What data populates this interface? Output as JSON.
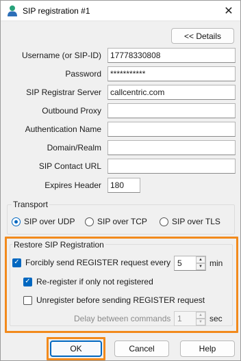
{
  "window": {
    "title": "SIP registration #1",
    "close_glyph": "✕"
  },
  "details_button": "<< Details",
  "fields": [
    {
      "label": "Username (or SIP-ID)",
      "value": "17778330808"
    },
    {
      "label": "Password",
      "value": "***********"
    },
    {
      "label": "SIP Registrar Server",
      "value": "callcentric.com"
    },
    {
      "label": "Outbound Proxy",
      "value": ""
    },
    {
      "label": "Authentication Name",
      "value": ""
    },
    {
      "label": "Domain/Realm",
      "value": ""
    },
    {
      "label": "SIP Contact URL",
      "value": ""
    }
  ],
  "expires": {
    "label": "Expires Header",
    "value": "180"
  },
  "transport": {
    "title": "Transport",
    "options": [
      {
        "label": "SIP over UDP",
        "selected": true
      },
      {
        "label": "SIP over TCP",
        "selected": false
      },
      {
        "label": "SIP over TLS",
        "selected": false
      }
    ]
  },
  "restore": {
    "title": "Restore SIP Registration",
    "force_label": "Forcibly send REGISTER request every",
    "force_checked": true,
    "force_value": "5",
    "force_unit": "min",
    "reregister_label": "Re-register if only not registered",
    "reregister_checked": true,
    "unregister_label": "Unregister before sending REGISTER request",
    "unregister_checked": false,
    "delay_label": "Delay between commands",
    "delay_value": "1",
    "delay_unit": "sec"
  },
  "buttons": {
    "ok": "OK",
    "cancel": "Cancel",
    "help": "Help"
  },
  "colors": {
    "accent": "#0067c0",
    "highlight": "#f28a1c"
  },
  "icons": {
    "title": "user-icon",
    "check": "✓"
  }
}
